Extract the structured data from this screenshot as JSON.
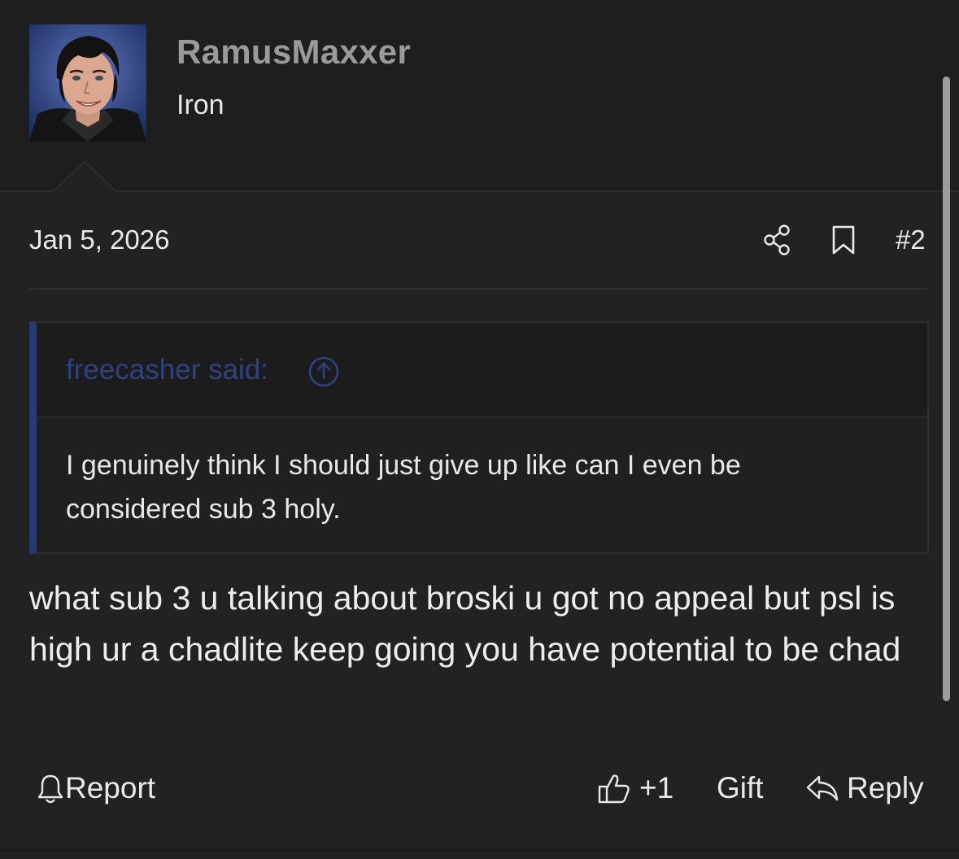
{
  "user": {
    "name": "RamusMaxxer",
    "title": "Iron"
  },
  "meta": {
    "date": "Jan 5, 2026",
    "post_number": "#2"
  },
  "quote": {
    "author_label": "freecasher said:",
    "text": "I genuinely think I should just give up like can I even be considered sub 3 holy."
  },
  "post": {
    "body": "what sub 3 u talking about broski u got no appeal but psl is high ur a chadlite keep going you have potential to be chad"
  },
  "actions": {
    "report_label": "Report",
    "like_label": "+1",
    "gift_label": "Gift",
    "reply_label": "Reply"
  },
  "icons": {
    "share": "share-icon",
    "bookmark": "bookmark-icon",
    "quote_jump": "arrow-up-circle-icon",
    "report": "bell-icon",
    "like": "thumbs-up-icon",
    "reply": "reply-arrow-icon"
  },
  "colors": {
    "background": "#222223",
    "header_background": "#1e1e1f",
    "quote_accent": "#2c3a72",
    "quote_author": "#2f4083",
    "username": "#9a9a9b",
    "text": "#ededed"
  }
}
